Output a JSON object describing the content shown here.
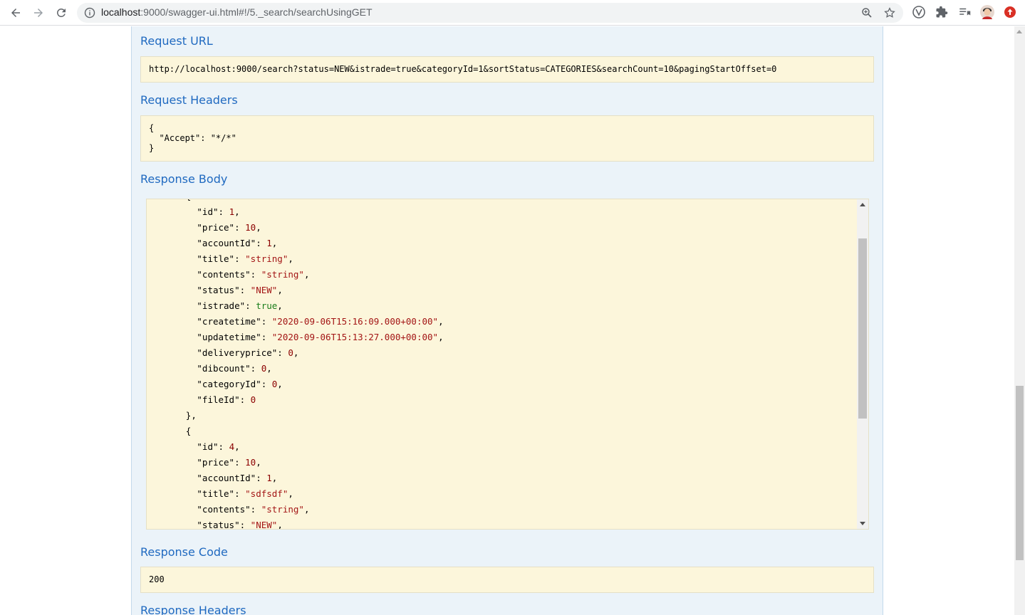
{
  "browser": {
    "url_host": "localhost",
    "url_rest": ":9000/swagger-ui.html#!/5._search/searchUsingGET"
  },
  "sections": {
    "request_url_title": "Request URL",
    "request_url": "http://localhost:9000/search?status=NEW&istrade=true&categoryId=1&sortStatus=CATEGORIES&searchCount=10&pagingStartOffset=0",
    "request_headers_title": "Request Headers",
    "request_headers": "{\n  \"Accept\": \"*/*\"\n}",
    "response_body_title": "Response Body",
    "response_code_title": "Response Code",
    "response_code": "200",
    "response_headers_title": "Response Headers"
  },
  "response_body": [
    {
      "indent": 6,
      "parts": [
        {
          "t": "{",
          "c": "k"
        }
      ]
    },
    {
      "indent": 8,
      "parts": [
        {
          "t": "\"id\"",
          "c": "k"
        },
        {
          "t": ": ",
          "c": "k"
        },
        {
          "t": "1",
          "c": "n"
        },
        {
          "t": ",",
          "c": "k"
        }
      ]
    },
    {
      "indent": 8,
      "parts": [
        {
          "t": "\"price\"",
          "c": "k"
        },
        {
          "t": ": ",
          "c": "k"
        },
        {
          "t": "10",
          "c": "n"
        },
        {
          "t": ",",
          "c": "k"
        }
      ]
    },
    {
      "indent": 8,
      "parts": [
        {
          "t": "\"accountId\"",
          "c": "k"
        },
        {
          "t": ": ",
          "c": "k"
        },
        {
          "t": "1",
          "c": "n"
        },
        {
          "t": ",",
          "c": "k"
        }
      ]
    },
    {
      "indent": 8,
      "parts": [
        {
          "t": "\"title\"",
          "c": "k"
        },
        {
          "t": ": ",
          "c": "k"
        },
        {
          "t": "\"string\"",
          "c": "s"
        },
        {
          "t": ",",
          "c": "k"
        }
      ]
    },
    {
      "indent": 8,
      "parts": [
        {
          "t": "\"contents\"",
          "c": "k"
        },
        {
          "t": ": ",
          "c": "k"
        },
        {
          "t": "\"string\"",
          "c": "s"
        },
        {
          "t": ",",
          "c": "k"
        }
      ]
    },
    {
      "indent": 8,
      "parts": [
        {
          "t": "\"status\"",
          "c": "k"
        },
        {
          "t": ": ",
          "c": "k"
        },
        {
          "t": "\"NEW\"",
          "c": "s"
        },
        {
          "t": ",",
          "c": "k"
        }
      ]
    },
    {
      "indent": 8,
      "parts": [
        {
          "t": "\"istrade\"",
          "c": "k"
        },
        {
          "t": ": ",
          "c": "k"
        },
        {
          "t": "true",
          "c": "b"
        },
        {
          "t": ",",
          "c": "k"
        }
      ]
    },
    {
      "indent": 8,
      "parts": [
        {
          "t": "\"createtime\"",
          "c": "k"
        },
        {
          "t": ": ",
          "c": "k"
        },
        {
          "t": "\"2020-09-06T15:16:09.000+00:00\"",
          "c": "s"
        },
        {
          "t": ",",
          "c": "k"
        }
      ]
    },
    {
      "indent": 8,
      "parts": [
        {
          "t": "\"updatetime\"",
          "c": "k"
        },
        {
          "t": ": ",
          "c": "k"
        },
        {
          "t": "\"2020-09-06T15:13:27.000+00:00\"",
          "c": "s"
        },
        {
          "t": ",",
          "c": "k"
        }
      ]
    },
    {
      "indent": 8,
      "parts": [
        {
          "t": "\"deliveryprice\"",
          "c": "k"
        },
        {
          "t": ": ",
          "c": "k"
        },
        {
          "t": "0",
          "c": "n"
        },
        {
          "t": ",",
          "c": "k"
        }
      ]
    },
    {
      "indent": 8,
      "parts": [
        {
          "t": "\"dibcount\"",
          "c": "k"
        },
        {
          "t": ": ",
          "c": "k"
        },
        {
          "t": "0",
          "c": "n"
        },
        {
          "t": ",",
          "c": "k"
        }
      ]
    },
    {
      "indent": 8,
      "parts": [
        {
          "t": "\"categoryId\"",
          "c": "k"
        },
        {
          "t": ": ",
          "c": "k"
        },
        {
          "t": "0",
          "c": "n"
        },
        {
          "t": ",",
          "c": "k"
        }
      ]
    },
    {
      "indent": 8,
      "parts": [
        {
          "t": "\"fileId\"",
          "c": "k"
        },
        {
          "t": ": ",
          "c": "k"
        },
        {
          "t": "0",
          "c": "n"
        }
      ]
    },
    {
      "indent": 6,
      "parts": [
        {
          "t": "},",
          "c": "k"
        }
      ]
    },
    {
      "indent": 6,
      "parts": [
        {
          "t": "{",
          "c": "k"
        }
      ]
    },
    {
      "indent": 8,
      "parts": [
        {
          "t": "\"id\"",
          "c": "k"
        },
        {
          "t": ": ",
          "c": "k"
        },
        {
          "t": "4",
          "c": "n"
        },
        {
          "t": ",",
          "c": "k"
        }
      ]
    },
    {
      "indent": 8,
      "parts": [
        {
          "t": "\"price\"",
          "c": "k"
        },
        {
          "t": ": ",
          "c": "k"
        },
        {
          "t": "10",
          "c": "n"
        },
        {
          "t": ",",
          "c": "k"
        }
      ]
    },
    {
      "indent": 8,
      "parts": [
        {
          "t": "\"accountId\"",
          "c": "k"
        },
        {
          "t": ": ",
          "c": "k"
        },
        {
          "t": "1",
          "c": "n"
        },
        {
          "t": ",",
          "c": "k"
        }
      ]
    },
    {
      "indent": 8,
      "parts": [
        {
          "t": "\"title\"",
          "c": "k"
        },
        {
          "t": ": ",
          "c": "k"
        },
        {
          "t": "\"sdfsdf\"",
          "c": "s"
        },
        {
          "t": ",",
          "c": "k"
        }
      ]
    },
    {
      "indent": 8,
      "parts": [
        {
          "t": "\"contents\"",
          "c": "k"
        },
        {
          "t": ": ",
          "c": "k"
        },
        {
          "t": "\"string\"",
          "c": "s"
        },
        {
          "t": ",",
          "c": "k"
        }
      ]
    },
    {
      "indent": 8,
      "parts": [
        {
          "t": "\"status\"",
          "c": "k"
        },
        {
          "t": ": ",
          "c": "k"
        },
        {
          "t": "\"NEW\"",
          "c": "s"
        },
        {
          "t": ",",
          "c": "k"
        }
      ]
    }
  ],
  "colors": {
    "title_blue": "#1f69c0",
    "panel_bg": "#ebf3f9",
    "box_bg": "#fcf6db",
    "string_color": "#a31515",
    "bool_color": "#1a7d1a"
  },
  "icons": [
    "back-arrow-icon",
    "forward-arrow-icon",
    "reload-icon",
    "info-icon",
    "zoom-icon",
    "star-icon",
    "vuejs-devtools-icon",
    "extensions-puzzle-icon",
    "reading-list-icon",
    "profile-avatar",
    "update-badge-icon"
  ]
}
